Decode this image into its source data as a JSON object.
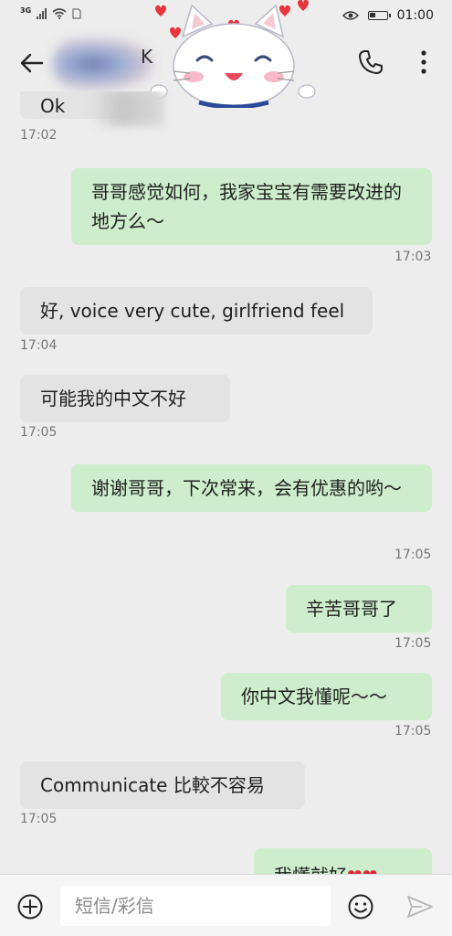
{
  "status_bar": {
    "network": "3G",
    "time": "01:00",
    "battery_level": 0.35
  },
  "header": {
    "contact_initial": "K",
    "back_icon": "arrow-left-icon",
    "call_icon": "phone-icon",
    "more_icon": "more-vertical-icon"
  },
  "messages": [
    {
      "side": "in",
      "text": "Ok",
      "time": "17:02"
    },
    {
      "side": "out",
      "text": "哥哥感觉如何，我家宝宝有需要改进的地方么～",
      "time": "17:03"
    },
    {
      "side": "in",
      "text": "好, voice very cute, girlfriend feel",
      "time": "17:04"
    },
    {
      "side": "in",
      "text": "可能我的中文不好",
      "time": "17:05"
    },
    {
      "side": "out",
      "text": "谢谢哥哥，下次常来，会有优惠的哟～",
      "time": "17:05"
    },
    {
      "side": "out",
      "text": "辛苦哥哥了",
      "time": "17:05"
    },
    {
      "side": "out",
      "text": "你中文我懂呢～～",
      "time": "17:05"
    },
    {
      "side": "in",
      "text": "Communicate 比較不容易",
      "time": "17:05"
    },
    {
      "side": "out",
      "text": "我懂就好",
      "emoji": "❤❤",
      "time": ""
    }
  ],
  "input_bar": {
    "placeholder": "短信/彩信",
    "value": ""
  },
  "colors": {
    "incoming_bubble": "#e3e3e3",
    "outgoing_bubble": "#cdedcc",
    "background": "#ededed"
  }
}
